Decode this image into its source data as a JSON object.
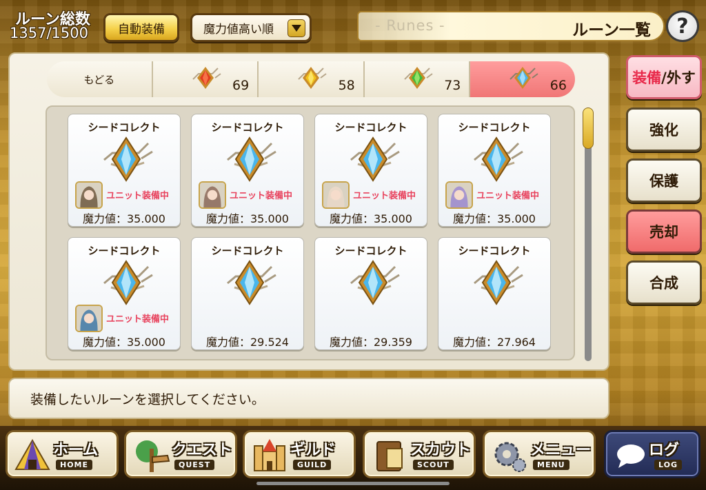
{
  "header": {
    "rune_count_label": "ルーン総数",
    "rune_count_value": "1357/1500",
    "auto_equip_label": "自動装備",
    "sort_value": "魔力値高い順",
    "title_en": "- Runes -",
    "title_jp": "ルーン一覧",
    "help_label": "?"
  },
  "tabs": [
    {
      "label": "もどる"
    },
    {
      "gem_color": "#e23b1e",
      "count": "69"
    },
    {
      "gem_color": "#f2c21a",
      "count": "58"
    },
    {
      "gem_color": "#3dbd3a",
      "count": "73"
    },
    {
      "gem_color": "#49b6ec",
      "count": "66",
      "active": true
    }
  ],
  "cards": [
    {
      "name": "シードコレクト",
      "power": "魔力値：35.000",
      "equipped": "ユニット装備中"
    },
    {
      "name": "シードコレクト",
      "power": "魔力値：35.000",
      "equipped": "ユニット装備中"
    },
    {
      "name": "シードコレクト",
      "power": "魔力値：35.000",
      "equipped": "ユニット装備中"
    },
    {
      "name": "シードコレクト",
      "power": "魔力値：35.000",
      "equipped": "ユニット装備中"
    },
    {
      "name": "シードコレクト",
      "power": "魔力値：35.000",
      "equipped": "ユニット装備中"
    },
    {
      "name": "シードコレクト",
      "power": "魔力値：29.524"
    },
    {
      "name": "シードコレクト",
      "power": "魔力値：29.359"
    },
    {
      "name": "シードコレクト",
      "power": "魔力値：27.964"
    }
  ],
  "side_actions": {
    "equip_a": "装備",
    "equip_b": "/外す",
    "enhance": "強化",
    "protect": "保護",
    "sell": "売却",
    "combine": "合成"
  },
  "message": "装備したいルーンを選択してください。",
  "nav": {
    "home_jp": "ホーム",
    "home_en": "HOME",
    "quest_jp": "クエスト",
    "quest_en": "QUEST",
    "guild_jp": "ギルド",
    "guild_en": "GUILD",
    "scout_jp": "スカウト",
    "scout_en": "SCOUT",
    "menu_jp": "メニュー",
    "menu_en": "MENU",
    "log_jp": "ログ",
    "log_en": "LOG"
  },
  "colors": {
    "accent_gold": "#d6a838",
    "equipped_text": "#e8415c",
    "active_tab": "#f07676",
    "sell_button": "#f06b6b"
  }
}
